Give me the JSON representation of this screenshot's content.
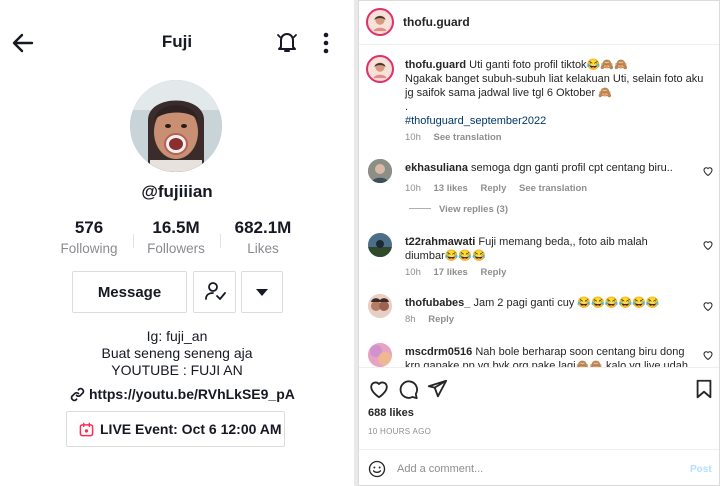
{
  "tiktok": {
    "title": "Fuji",
    "handle": "@fujiiian",
    "stats": [
      {
        "value": "576",
        "label": "Following"
      },
      {
        "value": "16.5M",
        "label": "Followers"
      },
      {
        "value": "682.1M",
        "label": "Likes"
      }
    ],
    "message_label": "Message",
    "bio": [
      "Ig: fuji_an",
      "Buat seneng seneng aja",
      "YOUTUBE : FUJI AN"
    ],
    "link": "https://youtu.be/RVhLkSE9_pA",
    "live_event": "LIVE Event: Oct 6 12:00 AM",
    "icons": {
      "back": "back-arrow-icon",
      "bell": "bell-icon",
      "more": "more-vertical-icon",
      "follow": "user-check-icon",
      "dropdown": "caret-down-icon",
      "link": "link-icon",
      "calendar": "calendar-icon"
    }
  },
  "instagram": {
    "username": "thofu.guard",
    "caption": {
      "user": "thofu.guard",
      "line1": "Uti ganti foto profil tiktok😂🙈🙈",
      "line2": "Ngakak banget subuh-subuh liat kelakuan Uti, selain foto aku jg saifok sama jadwal live tgl 6 Oktober 🙈",
      "dot": ".",
      "hashtag": "#thofuguard_september2022",
      "time": "10h",
      "see_translation": "See translation"
    },
    "comments": [
      {
        "user": "ekhasuliana",
        "text": "semoga dgn ganti profil cpt centang biru..",
        "time": "10h",
        "likes": "13 likes",
        "reply": "Reply",
        "see_translation": "See translation",
        "view_replies": "View replies (3)"
      },
      {
        "user": "t22rahmawati",
        "text": "Fuji memang beda,, foto aib malah diumbar😂😂😂",
        "time": "10h",
        "likes": "17 likes",
        "reply": "Reply"
      },
      {
        "user": "thofubabes_",
        "text": "Jam 2 pagi ganti cuy 😂😂😂😂😂😂",
        "time": "8h",
        "reply": "Reply"
      },
      {
        "user": "mscdrm0516",
        "text": "Nah bole berharap soon centang biru dong krn gapake pp yg byk org pake lagi🙈🙈 kalo yg live udah ada dari"
      }
    ],
    "likes": "688 likes",
    "timestamp": "10 HOURS AGO",
    "add_comment_placeholder": "Add a comment...",
    "post_label": "Post",
    "colors": {
      "hashtag": "#00376b",
      "ring": "#e1306c",
      "post": "#b2dffc"
    },
    "icons": {
      "like": "heart-icon",
      "comment": "comment-icon",
      "share": "send-icon",
      "save": "bookmark-icon",
      "emoji": "emoji-icon"
    }
  }
}
